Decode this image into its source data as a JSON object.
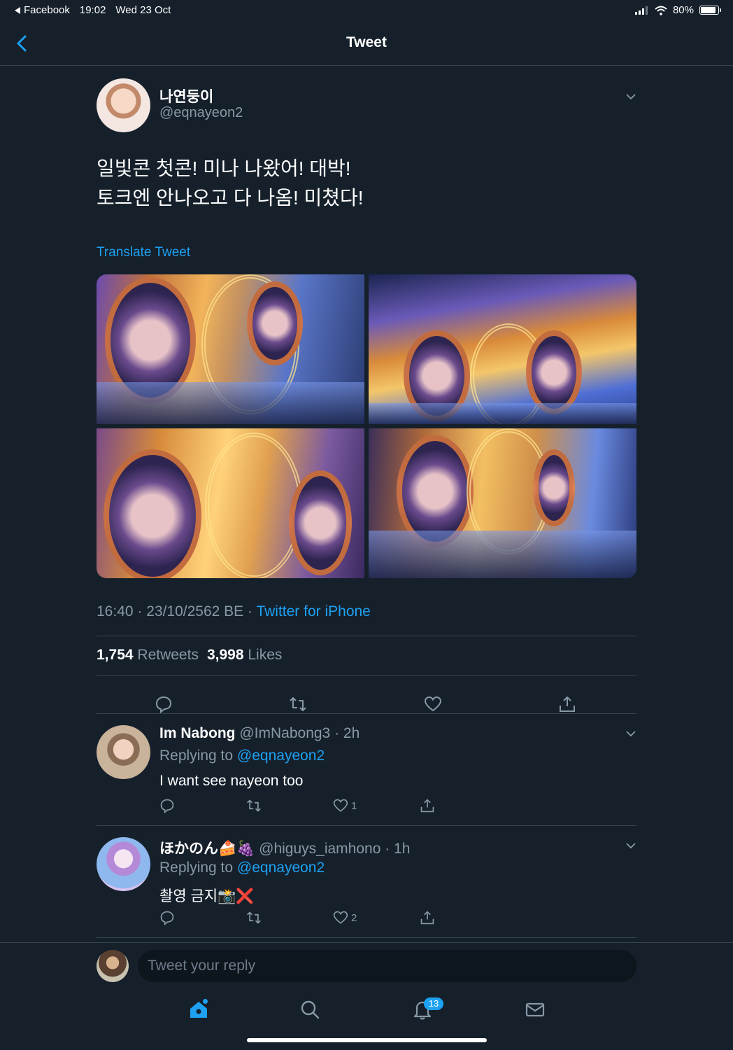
{
  "status_bar": {
    "back_app": "Facebook",
    "time": "19:02",
    "date": "Wed 23 Oct",
    "battery": "80%",
    "battery_level": 0.8
  },
  "nav": {
    "title": "Tweet"
  },
  "tweet": {
    "author_name": "나연둥이",
    "author_handle": "@eqnayeon2",
    "text_line1": "일빛콘 첫콘! 미나 나왔어! 대박!",
    "text_line2": "토크엔 안나오고 다 나옴! 미쳤다!",
    "translate_label": "Translate Tweet",
    "timestamp": "16:40 · 23/10/2562 BE · ",
    "source": "Twitter for iPhone",
    "retweets_count": "1,754",
    "retweets_label": "Retweets",
    "likes_count": "3,998",
    "likes_label": "Likes"
  },
  "replies": [
    {
      "name": "Im Nabong",
      "handle": "@ImNabong3 · 2h",
      "replying_prefix": "Replying to ",
      "replying_to": "@eqnayeon2",
      "text": "I want see nayeon too",
      "like_count": "1"
    },
    {
      "name": "ほかのん🍰🍇",
      "handle": "@higuys_iamhono · 1h",
      "replying_prefix": "Replying to ",
      "replying_to": "@eqnayeon2",
      "text": "촬영 금지📸❌",
      "like_count": "2"
    }
  ],
  "compose": {
    "placeholder": "Tweet your reply"
  },
  "tab_bar": {
    "notifications_badge": "13"
  },
  "colors": {
    "background": "#15202b",
    "accent": "#1da1f2",
    "secondary_text": "#8899a6",
    "divider": "#38444d"
  }
}
